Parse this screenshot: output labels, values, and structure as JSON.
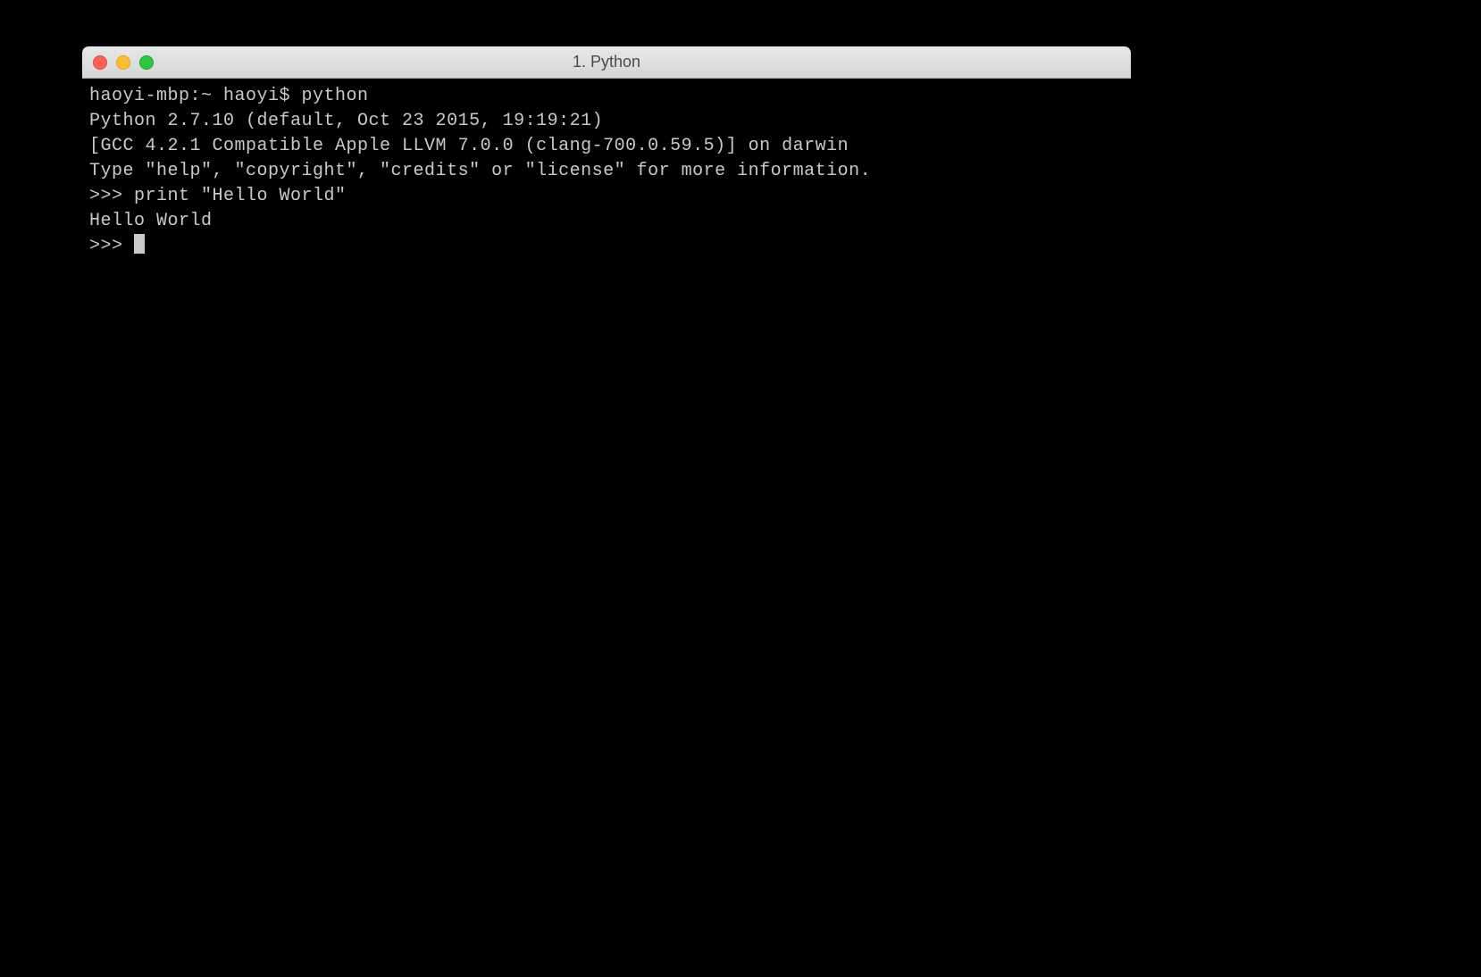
{
  "window": {
    "title": "1. Python"
  },
  "traffic_lights": {
    "close_color": "#ff5f57",
    "minimize_color": "#ffbd2e",
    "maximize_color": "#28c940"
  },
  "terminal": {
    "lines": [
      "haoyi-mbp:~ haoyi$ python",
      "Python 2.7.10 (default, Oct 23 2015, 19:19:21)",
      "[GCC 4.2.1 Compatible Apple LLVM 7.0.0 (clang-700.0.59.5)] on darwin",
      "Type \"help\", \"copyright\", \"credits\" or \"license\" for more information.",
      ">>> print \"Hello World\"",
      "Hello World"
    ],
    "current_prompt": ">>> "
  }
}
